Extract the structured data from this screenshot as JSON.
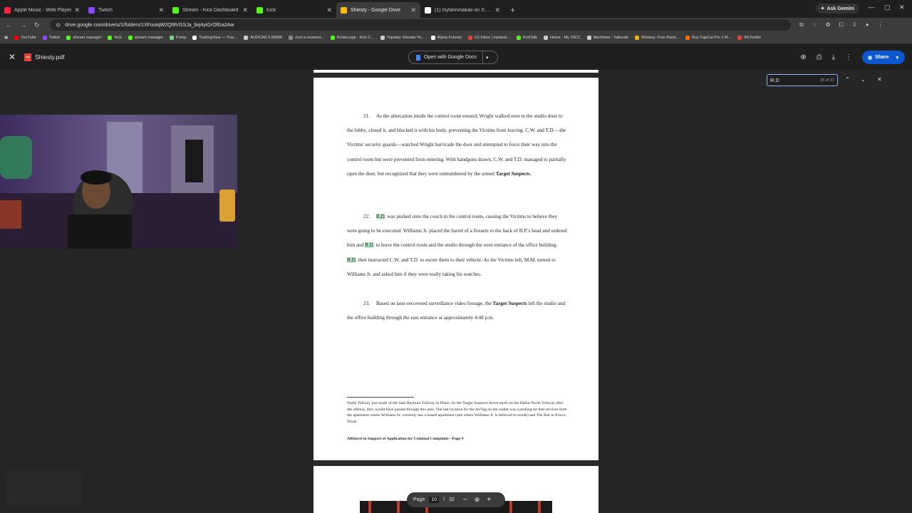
{
  "tabs": [
    {
      "title": "Apple Music - Web Player",
      "color": "#fa233b"
    },
    {
      "title": "Twitch",
      "color": "#9146ff"
    },
    {
      "title": "Stream - Kick Dashboard",
      "color": "#53fc18"
    },
    {
      "title": "Kick",
      "color": "#53fc18"
    },
    {
      "title": "Shiesty - Google Drive",
      "color": "#fbbc04",
      "active": true
    },
    {
      "title": "(1) mylannmakaii on X: \"????? h",
      "color": "#ffffff"
    }
  ],
  "gemini_label": "Ask Gemini",
  "url": "drive.google.com/drive/u/1/folders/1XFoutqW2Qt9VGSJa_bxj4yiGrOfGa2Aw",
  "bookmarks": [
    "YouTube",
    "Twitch",
    "stream manager",
    "Kick",
    "stream manager",
    "Pump",
    "TradingView — Trac...",
    "AUDCAD 0.89596",
    "Just a moment...",
    "Kicklet.app - Kick C...",
    "Topstep: Elevate Yo...",
    "Alpha Futures",
    "(1) Inbox | mylanai...",
    "KickTalk",
    "Home - My JSCC",
    "Machines - Tailscale",
    "Monkey: Free Rand...",
    "Buy CapCut Pro 1 M...",
    "IRLToolkit"
  ],
  "file": {
    "name": "Shiesty.pdf",
    "pdf_badge": "PDF"
  },
  "open_with": "Open with Google Docs",
  "share_label": "Share",
  "find": {
    "query": "R.D",
    "count": "25 of 37"
  },
  "document": {
    "para21_num": "21.",
    "para21": "As the altercation inside the control room ensued, Wright walked over to the studio door to the lobby, closed it, and blocked it with his body, preventing the Victims from leaving. C.W. and T.D.—the Victims' security guards—watched Wright barricade the door and attempted to force their way into the control room but were prevented from entering. With handguns drawn, C.W. and T.D. managed to partially open the door, but recognized that they were outnumbered by the armed",
    "para21_bold": "Target Suspects",
    "para21_end": ".",
    "para22_num": "22.",
    "rd": "R.D",
    "para22_a": ". was pushed onto the couch in the control room, causing the Victims to believe they were going to be executed. Williams Jr. placed the barrel of a firearm to the back of B.P.'s head and ordered him and",
    "para22_b": ". to leave the control room and the studio through the west entrance of the office building.",
    "para22_c": ". then instructed C.W. and T.D. to escort them to their vehicle. As the Victims left, M.M. turned to Williams Jr. and asked him if they were really taking his watches.",
    "para23_num": "23.",
    "para23_a": "Based on later-recovered surveillance video footage, the",
    "para23_bold": "Target Suspects",
    "para23_b": "left the studio and the office building through the east entrance at approximately 4:48 p.m.",
    "footnote": "North Tollway just south of the Sam Rayburn Tollway in Plano. As the Target Suspects drove north on the Dallas North Tollway after the offense, they would have passed through this area. The last location for the AirTag on the wallet was a parking lot that services both the apartment where Williams Sr. currently has a leased apartment (and where Williams Jr. is believed to reside) and The Star in Frisco, Texas.",
    "footer": "Affidavit in Support of Application for Criminal Complaint—Page 9"
  },
  "pager": {
    "label": "Page",
    "current": "10",
    "sep": "/",
    "total": "32"
  }
}
